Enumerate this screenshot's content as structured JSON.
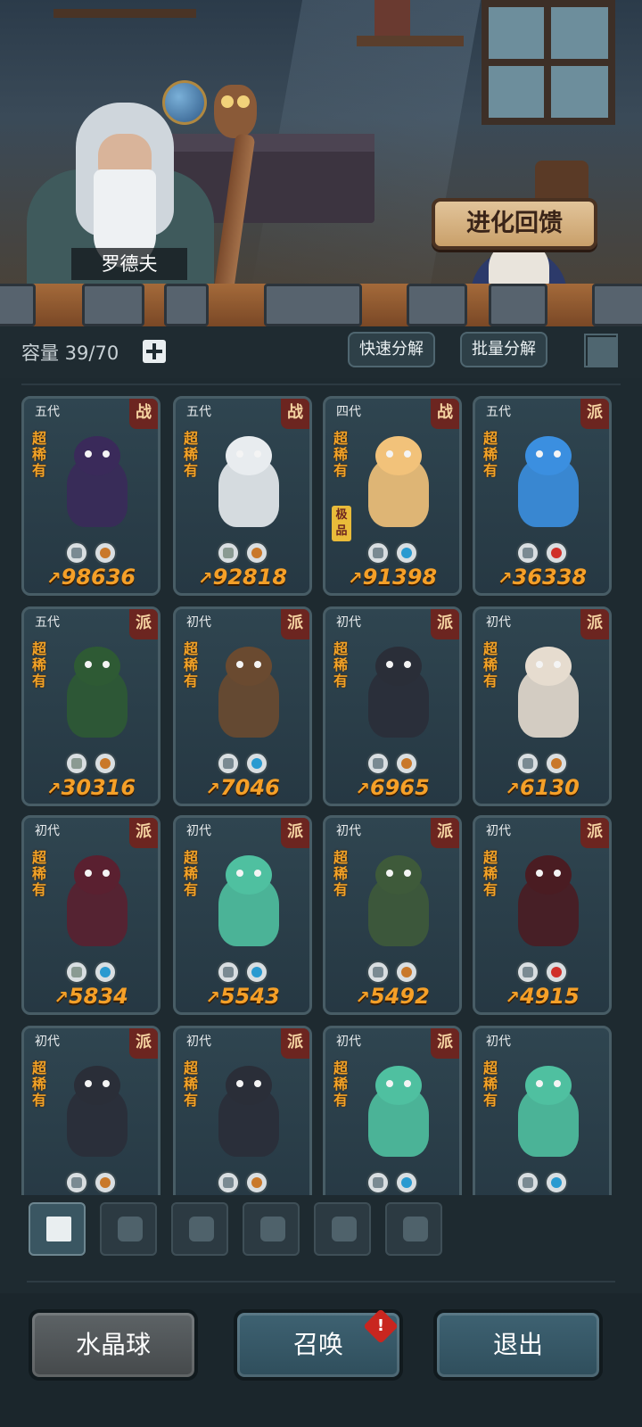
{
  "header": {
    "npc_name": "罗德夫",
    "evolution_button": "进化回馈"
  },
  "toolbar": {
    "capacity": "容量 39/70",
    "quick_decompose": "快速分解",
    "batch_decompose": "批量分解"
  },
  "cards": [
    {
      "gen": "五代",
      "faction": "战",
      "rarity": "超稀有",
      "power": "98636",
      "extra": "",
      "color": "#3a2a5a",
      "icon1": "shield-icon",
      "icon2": "earth-icon"
    },
    {
      "gen": "五代",
      "faction": "战",
      "rarity": "超稀有",
      "power": "92818",
      "extra": "",
      "color": "#e8ecef",
      "icon1": "leaf-icon",
      "icon2": "earth-icon"
    },
    {
      "gen": "四代",
      "faction": "战",
      "rarity": "超稀有",
      "power": "91398",
      "extra": "极品",
      "color": "#f2c27a",
      "icon1": "shield-icon",
      "icon2": "water-icon"
    },
    {
      "gen": "五代",
      "faction": "派",
      "rarity": "超稀有",
      "power": "36338",
      "extra": "",
      "color": "#3b8fe0",
      "icon1": "fist-icon",
      "icon2": "fire-icon"
    },
    {
      "gen": "五代",
      "faction": "派",
      "rarity": "超稀有",
      "power": "30316",
      "extra": "",
      "color": "#2e5a34",
      "icon1": "leaf-icon",
      "icon2": "earth-icon"
    },
    {
      "gen": "初代",
      "faction": "派",
      "rarity": "超稀有",
      "power": "7046",
      "extra": "",
      "color": "#6a4a30",
      "icon1": "shield-icon",
      "icon2": "water-icon"
    },
    {
      "gen": "初代",
      "faction": "派",
      "rarity": "超稀有",
      "power": "6965",
      "extra": "",
      "color": "#2a2e38",
      "icon1": "fist-icon",
      "icon2": "earth-icon"
    },
    {
      "gen": "初代",
      "faction": "派",
      "rarity": "超稀有",
      "power": "6130",
      "extra": "",
      "color": "#e6dccf",
      "icon1": "fist-icon",
      "icon2": "earth-icon"
    },
    {
      "gen": "初代",
      "faction": "派",
      "rarity": "超稀有",
      "power": "5834",
      "extra": "",
      "color": "#5a2030",
      "icon1": "leaf-icon",
      "icon2": "water-icon"
    },
    {
      "gen": "初代",
      "faction": "派",
      "rarity": "超稀有",
      "power": "5543",
      "extra": "",
      "color": "#4fc0a0",
      "icon1": "fist-icon",
      "icon2": "water-icon"
    },
    {
      "gen": "初代",
      "faction": "派",
      "rarity": "超稀有",
      "power": "5492",
      "extra": "",
      "color": "#3e5a3a",
      "icon1": "shield-icon",
      "icon2": "earth-icon"
    },
    {
      "gen": "初代",
      "faction": "派",
      "rarity": "超稀有",
      "power": "4915",
      "extra": "",
      "color": "#4a1c22",
      "icon1": "shield-icon",
      "icon2": "fire-icon"
    },
    {
      "gen": "初代",
      "faction": "派",
      "rarity": "超稀有",
      "power": "",
      "extra": "",
      "color": "#2a2e38",
      "icon1": "fist-icon",
      "icon2": "earth-icon"
    },
    {
      "gen": "初代",
      "faction": "派",
      "rarity": "超稀有",
      "power": "",
      "extra": "",
      "color": "#2a2e38",
      "icon1": "fist-icon",
      "icon2": "earth-icon"
    },
    {
      "gen": "初代",
      "faction": "派",
      "rarity": "超稀有",
      "power": "",
      "extra": "",
      "color": "#4fc0a0",
      "icon1": "fist-icon",
      "icon2": "water-icon"
    },
    {
      "gen": "初代",
      "faction": "",
      "rarity": "超稀有",
      "power": "",
      "extra": "",
      "color": "#4fc0a0",
      "icon1": "fist-icon",
      "icon2": "water-icon"
    }
  ],
  "icon_colors": {
    "shield-icon": "#7a8a92",
    "leaf-icon": "#8a9a92",
    "fist-icon": "#7a8a92",
    "earth-icon": "#c9782a",
    "water-icon": "#2a9ad0",
    "fire-icon": "#d0302a"
  },
  "filter_tabs": [
    "all-icon",
    "fist-icon",
    "shield-icon",
    "leaf-icon",
    "spirit-icon",
    "tower-icon"
  ],
  "bottom": {
    "crystal_ball": "水晶球",
    "summon": "召唤",
    "exit": "退出",
    "alert_mark": "!"
  }
}
